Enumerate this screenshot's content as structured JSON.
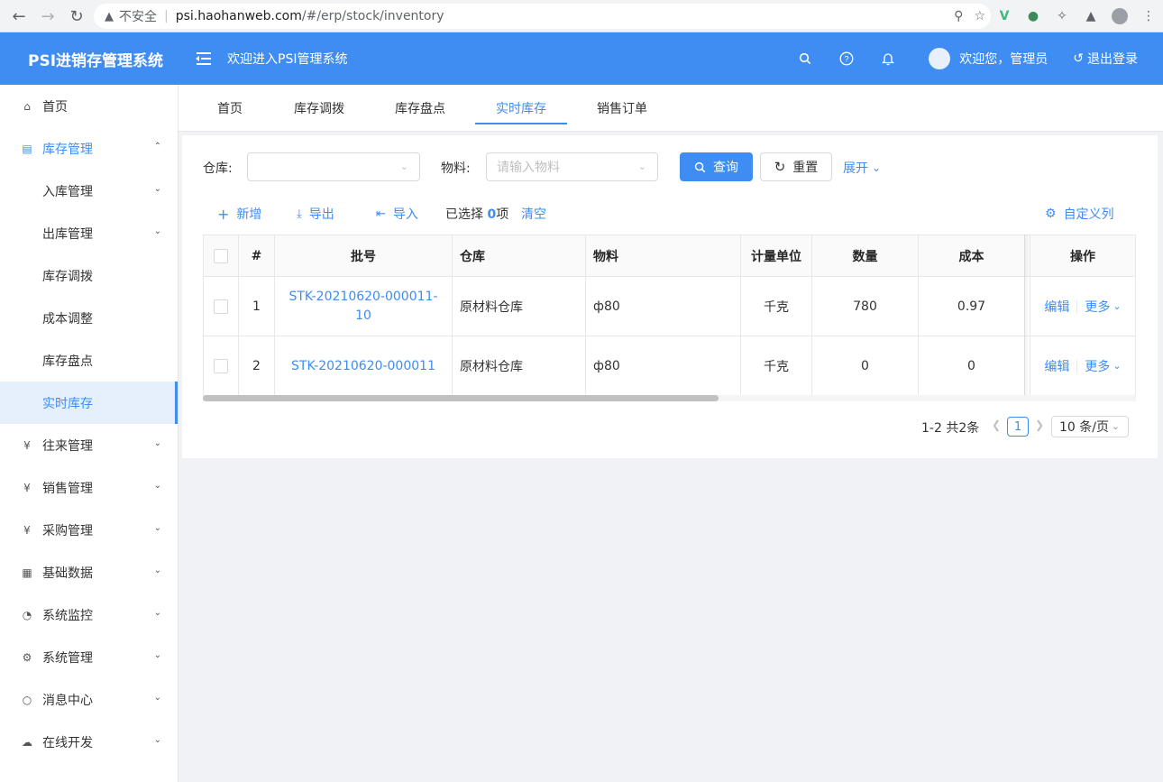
{
  "browser": {
    "insecure_label": "不安全",
    "url_host": "psi.haohanweb.com",
    "url_path": "/#/erp/stock/inventory"
  },
  "header": {
    "logo": "PSI进销存管理系统",
    "welcome": "欢迎进入PSI管理系统",
    "user_greeting": "欢迎您，管理员",
    "logout": "退出登录"
  },
  "sidebar": {
    "items": [
      {
        "label": "首页",
        "icon": "home-icon"
      },
      {
        "label": "库存管理",
        "icon": "inventory-icon"
      },
      {
        "label": "入库管理"
      },
      {
        "label": "出库管理"
      },
      {
        "label": "库存调拨"
      },
      {
        "label": "成本调整"
      },
      {
        "label": "库存盘点"
      },
      {
        "label": "实时库存"
      },
      {
        "label": "往来管理",
        "icon": "yen-icon"
      },
      {
        "label": "销售管理",
        "icon": "yen-icon"
      },
      {
        "label": "采购管理",
        "icon": "yen-icon"
      },
      {
        "label": "基础数据",
        "icon": "table-icon"
      },
      {
        "label": "系统监控",
        "icon": "dashboard-icon"
      },
      {
        "label": "系统管理",
        "icon": "gear-icon"
      },
      {
        "label": "消息中心",
        "icon": "message-icon"
      },
      {
        "label": "在线开发",
        "icon": "cloud-icon"
      }
    ]
  },
  "tabs": [
    "首页",
    "库存调拨",
    "库存盘点",
    "实时库存",
    "销售订单"
  ],
  "filter": {
    "warehouse_label": "仓库:",
    "material_label": "物料:",
    "material_placeholder": "请输入物料",
    "query": "查询",
    "reset": "重置",
    "expand": "展开"
  },
  "toolbar": {
    "add": "新增",
    "export": "导出",
    "import": "导入",
    "selected_prefix": "已选择",
    "selected_count": "0",
    "selected_suffix": "项",
    "clear": "清空",
    "custom_columns": "自定义列"
  },
  "table": {
    "headers": [
      "#",
      "批号",
      "仓库",
      "物料",
      "计量单位",
      "数量",
      "成本",
      "操作"
    ],
    "rows": [
      {
        "index": "1",
        "batch_line1": "STK-20210620-000011-",
        "batch_line2": "10",
        "warehouse": "原材料仓库",
        "material": "ф80",
        "unit": "千克",
        "qty": "780",
        "cost": "0.97",
        "edit": "编辑",
        "more": "更多"
      },
      {
        "index": "2",
        "batch_line1": "STK-20210620-000011",
        "batch_line2": "",
        "warehouse": "原材料仓库",
        "material": "ф80",
        "unit": "千克",
        "qty": "0",
        "cost": "0",
        "edit": "编辑",
        "more": "更多"
      }
    ]
  },
  "pagination": {
    "total": "1-2 共2条",
    "current": "1",
    "page_size": "10 条/页"
  },
  "colors": {
    "primary": "#3f8cf2"
  }
}
